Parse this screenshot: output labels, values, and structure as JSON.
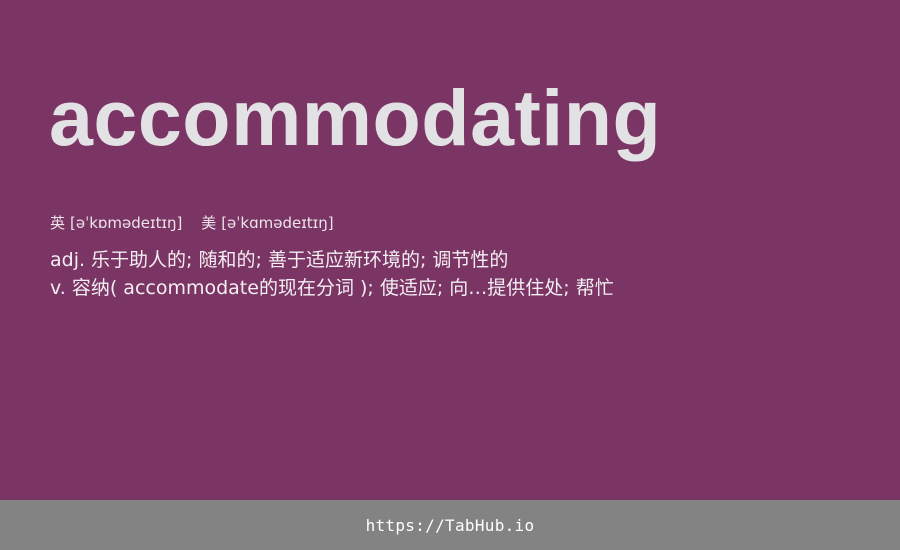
{
  "word": "accommodating",
  "phonetics": [
    {
      "region": "英",
      "ipa": "[əˈkɒmədeɪtɪŋ]"
    },
    {
      "region": "美",
      "ipa": "[əˈkɑmədeɪtɪŋ]"
    }
  ],
  "definitions": [
    "adj. 乐于助人的; 随和的; 善于适应新环境的; 调节性的",
    "v. 容纳( accommodate的现在分词 ); 使适应; 向…提供住处; 帮忙"
  ],
  "footer": {
    "link": "https://TabHub.io"
  },
  "colors": {
    "card_background": "#7b3564",
    "word_text": "#e2e2e4",
    "footer_background": "#838383"
  }
}
